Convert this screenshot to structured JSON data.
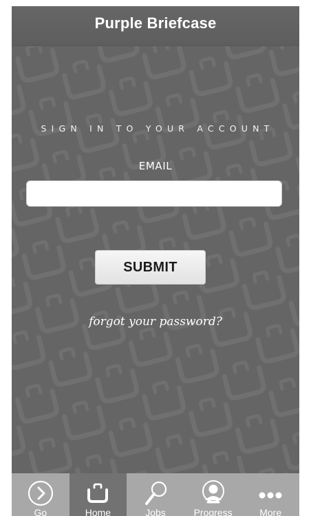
{
  "app": {
    "title": "Purple Briefcase"
  },
  "signin": {
    "heading": "SIGN IN TO YOUR ACCOUNT",
    "email_label": "EMAIL",
    "email_value": "",
    "email_placeholder": "",
    "submit_label": "SUBMIT",
    "forgot_label": "forgot your password?"
  },
  "tabbar": {
    "items": [
      {
        "label": "Go",
        "icon": "go-arrow-circle-icon",
        "active": false
      },
      {
        "label": "Home",
        "icon": "briefcase-icon",
        "active": true
      },
      {
        "label": "Jobs",
        "icon": "magnifier-icon",
        "active": false
      },
      {
        "label": "Progress",
        "icon": "user-profile-icon",
        "active": false
      },
      {
        "label": "More",
        "icon": "more-dots-icon",
        "active": false
      }
    ]
  },
  "colors": {
    "background": "#666565",
    "topbar": "#616161",
    "tabbar": "#a8a8a8",
    "tab_active": "#727272",
    "text": "#ffffff",
    "pattern": "#6f6e6e"
  }
}
